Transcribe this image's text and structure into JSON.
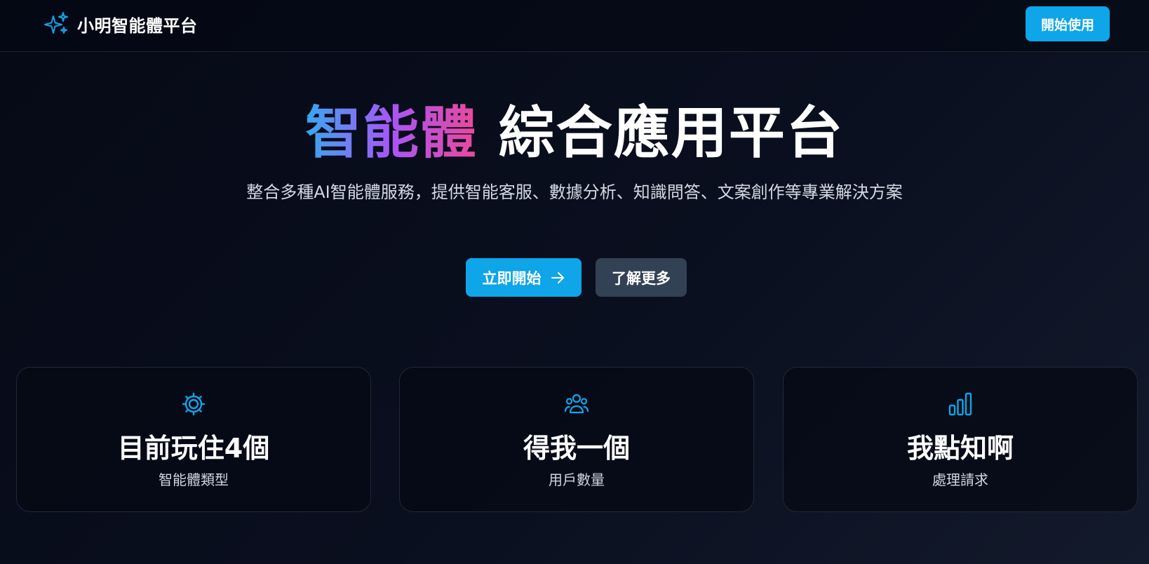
{
  "header": {
    "brand_name": "小明智能體平台",
    "brand_icon": "sparkles-icon",
    "cta_label": "開始使用"
  },
  "hero": {
    "title_highlight": "智能體",
    "title_rest": "綜合應用平台",
    "subtitle": "整合多種AI智能體服務，提供智能客服、數據分析、知識問答、文案創作等專業解決方案",
    "primary_button": "立即開始",
    "primary_button_icon": "arrow-right-icon",
    "secondary_button": "了解更多"
  },
  "stats": [
    {
      "icon": "gear-icon",
      "value": "目前玩住4個",
      "label": "智能體類型"
    },
    {
      "icon": "users-icon",
      "value": "得我一個",
      "label": "用戶數量"
    },
    {
      "icon": "bar-chart-icon",
      "value": "我點知啊",
      "label": "處理請求"
    }
  ],
  "colors": {
    "accent": "#0ea5e9",
    "secondary_button": "#334155",
    "gradient_start": "#38a8f0",
    "gradient_mid": "#a855f7",
    "gradient_end": "#ec4899"
  }
}
